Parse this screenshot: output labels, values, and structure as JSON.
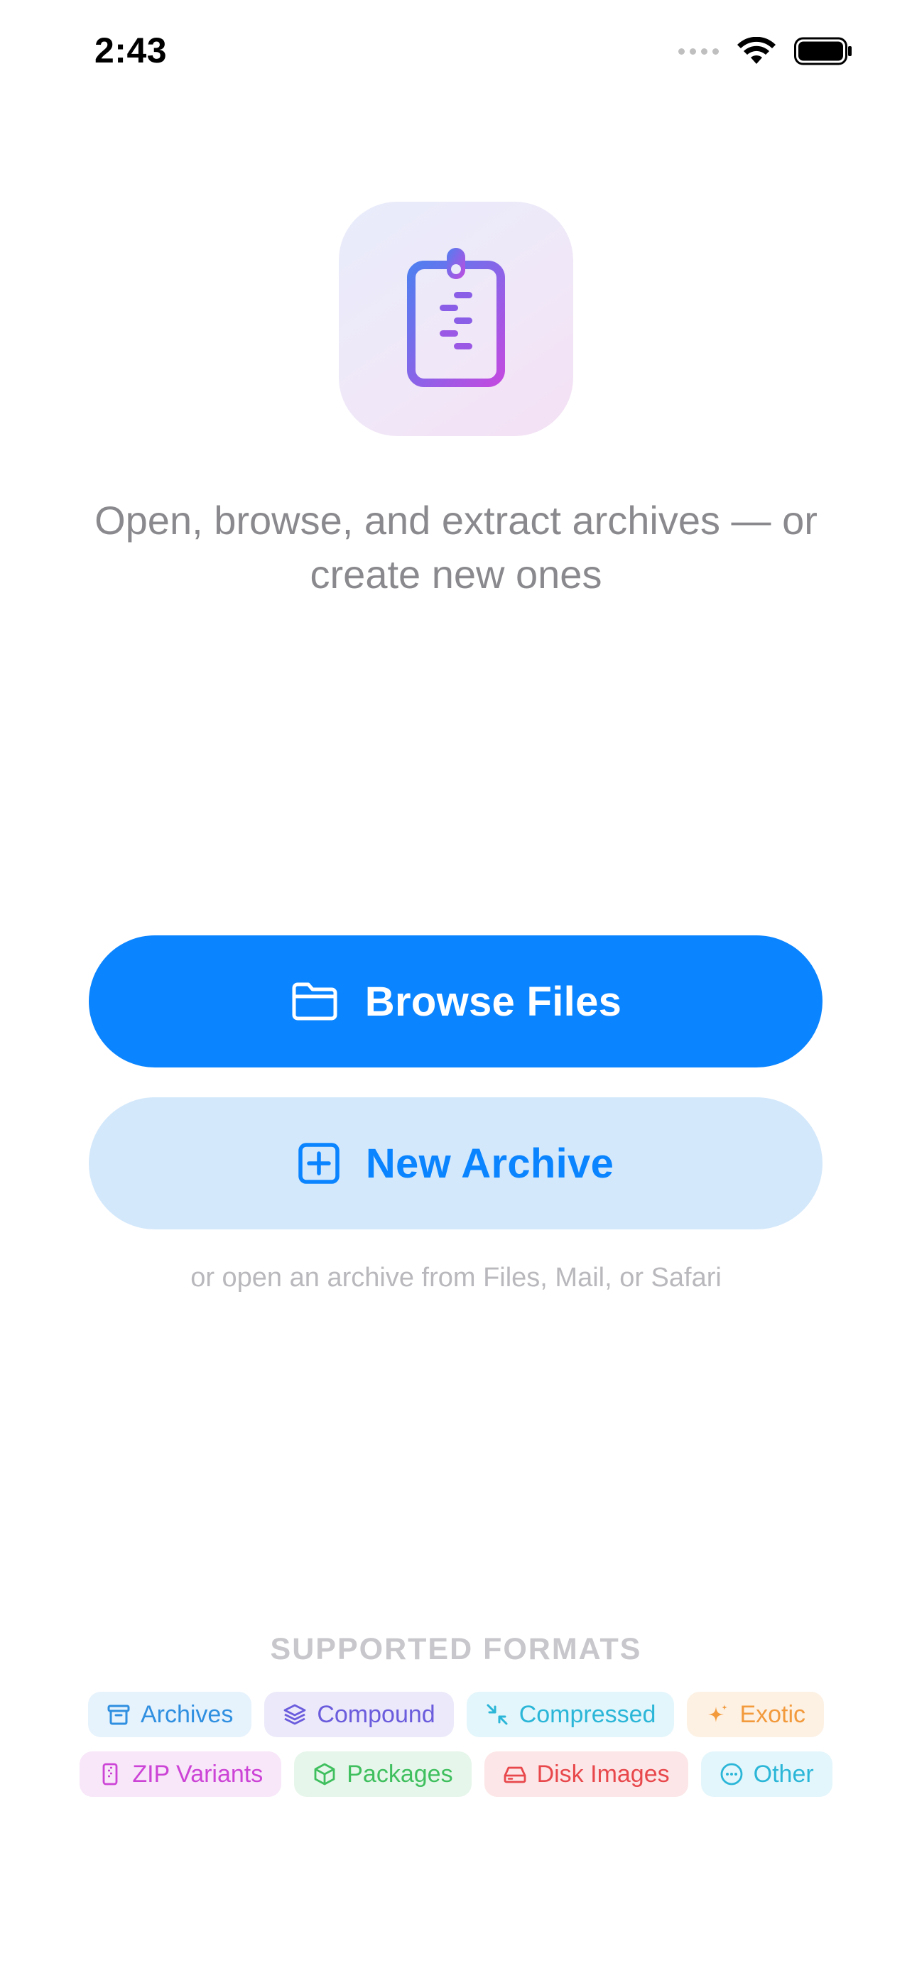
{
  "status_bar": {
    "time": "2:43"
  },
  "welcome": {
    "tagline": "Open, browse, and extract archives — or create new ones"
  },
  "actions": {
    "browse_label": "Browse Files",
    "new_archive_label": "New Archive",
    "hint": "or open an archive from Files, Mail, or Safari"
  },
  "formats": {
    "title": "SUPPORTED FORMATS",
    "row1": [
      {
        "label": "Archives",
        "icon": "archive-box-icon",
        "color": "#2f8fe0",
        "bg": "#e6f2fc"
      },
      {
        "label": "Compound",
        "icon": "layers-icon",
        "color": "#6a5cdc",
        "bg": "#ece9fa"
      },
      {
        "label": "Compressed",
        "icon": "compress-arrows-icon",
        "color": "#2bb6d8",
        "bg": "#e3f6fb"
      },
      {
        "label": "Exotic",
        "icon": "sparkle-icon",
        "color": "#f29a3c",
        "bg": "#fdf1e4"
      }
    ],
    "row2": [
      {
        "label": "ZIP Variants",
        "icon": "zip-file-icon",
        "color": "#cc44d6",
        "bg": "#f8e6f9"
      },
      {
        "label": "Packages",
        "icon": "package-icon",
        "color": "#3fbf5e",
        "bg": "#e6f6ea"
      },
      {
        "label": "Disk Images",
        "icon": "disk-drive-icon",
        "color": "#e8484c",
        "bg": "#fce6e7"
      },
      {
        "label": "Other",
        "icon": "ellipsis-circle-icon",
        "color": "#2bb6d8",
        "bg": "#e3f6fb"
      }
    ]
  },
  "colors": {
    "accent": "#0a84ff",
    "accent_light": "#d3e8fb"
  }
}
